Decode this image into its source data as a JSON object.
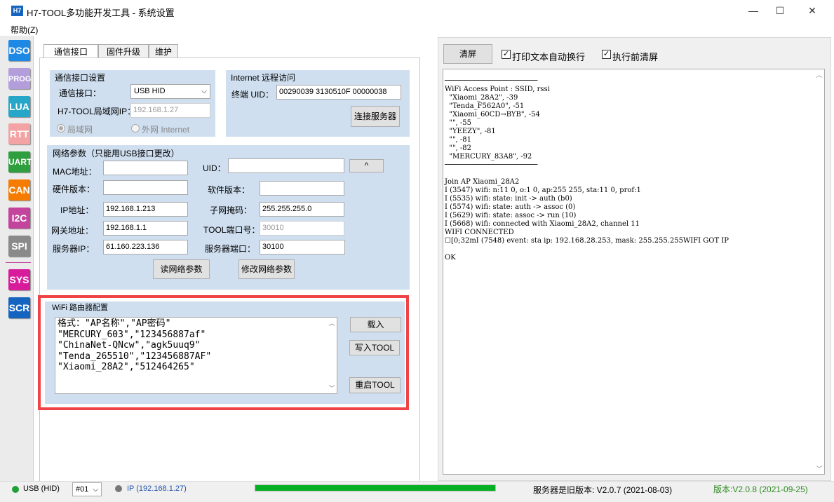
{
  "window": {
    "app_icon": "H7",
    "title": "H7-TOOL多功能开发工具 - 系统设置",
    "minimize": "—",
    "maximize": "☐",
    "close": "✕"
  },
  "menu": {
    "help": "帮助(Z)"
  },
  "sidebar": {
    "items": [
      {
        "label": "DSO",
        "color": "#1e88e5"
      },
      {
        "label": "PROG",
        "color": "#b39ddb"
      },
      {
        "label": "LUA",
        "color": "#26a6c9"
      },
      {
        "label": "RTT",
        "color": "#f3a3a3"
      },
      {
        "label": "UART",
        "color": "#2e9e3e"
      },
      {
        "label": "CAN",
        "color": "#f57c00"
      },
      {
        "label": "I2C",
        "color": "#c2449c"
      },
      {
        "label": "SPI",
        "color": "#8a8a8a"
      },
      {
        "label": "SYS",
        "color": "#d81b9a"
      },
      {
        "label": "SCR",
        "color": "#1565c0"
      }
    ]
  },
  "tabs": [
    "通信接口",
    "固件升级",
    "维护"
  ],
  "comm": {
    "group_title": "通信接口设置",
    "iface_label": "通信接口：",
    "iface_value": "USB HID",
    "lan_ip_label": "H7-TOOL局域网IP：",
    "lan_ip_value": "192.168.1.27",
    "radio_lan": "局域网",
    "radio_internet": "外网 Internet"
  },
  "internet": {
    "group_title": "Internet 远程访问",
    "uid_label": "终端 UID：",
    "uid_value": "00290039 3130510F 00000038",
    "connect_button": "连接服务器"
  },
  "network": {
    "group_title": "网络参数（只能用USB接口更改）",
    "mac_label": "MAC地址：",
    "mac_value": "",
    "uid_label": "UID：",
    "uid_value": "",
    "up_button": "^",
    "hw_label": "硬件版本：",
    "hw_value": "",
    "sw_label": "软件版本：",
    "sw_value": "",
    "ip_label": "IP地址：",
    "ip_value": "192.168.1.213",
    "mask_label": "子网掩码：",
    "mask_value": "255.255.255.0",
    "gw_label": "网关地址：",
    "gw_value": "192.168.1.1",
    "port_label": "TOOL端口号：",
    "port_value": "30010",
    "server_ip_label": "服务器IP：",
    "server_ip_value": "61.160.223.136",
    "server_port_label": "服务器端口：",
    "server_port_value": "30100",
    "read_button": "读网络参数",
    "write_button": "修改网络参数"
  },
  "wifi": {
    "group_title": "WiFi 路由器配置",
    "text": "格式：\"AP名称\",\"AP密码\"\n\"MERCURY_603\",\"123456887af\"\n\"ChinaNet-QNcw\",\"agk5uuq9\"\n\"Tenda_265510\",\"123456887AF\"\n\"Xiaomi_28A2\",\"512464265\"",
    "load_button": "载入",
    "write_button": "写入TOOL",
    "restart_button": "重启TOOL"
  },
  "right": {
    "clear_button": "清屏",
    "wrap_label": "打印文本自动换行",
    "wrap_checked": "✓",
    "clear_before_label": "执行前清屏",
    "clear_before_checked": "✓",
    "console_text": "──────────────────────\nWiFi Access Point : SSID, rssi\n  \"Xiaomi_28A2\", -39\n  \"Tenda_F562A0\", -51\n  \"Xiaomi_60CD→BYB\", -54\n  \"\", -55\n  \"YEEZY\", -81\n  \"\", -81\n  \"\", -82\n  \"MERCURY_83A8\", -92\n──────────────────────\n\nJoin AP Xiaomi_28A2\nI (3547) wifi: n:11 0, o:1 0, ap:255 255, sta:11 0, prof:1\nI (5535) wifi: state: init -> auth (b0)\nI (5574) wifi: state: auth -> assoc (0)\nI (5629) wifi: state: assoc -> run (10)\nI (5668) wifi: connected with Xiaomi_28A2, channel 11\nWIFI CONNECTED\n☐[0;32mI (7548) event: sta ip: 192.168.28.253, mask: 255.255.255WIFI GOT IP\n\nOK"
  },
  "status": {
    "usb": "USB (HID)",
    "usb_color": "#21a038",
    "device": "#01",
    "ip": "IP (192.168.1.27)",
    "ip_color": "#777777",
    "progress": 1.0,
    "server_version": "服务器是旧版本: V2.0.7 (2021-08-03)",
    "version": "版本:V2.0.8 (2021-09-25)",
    "version_color": "#2e8b20"
  }
}
